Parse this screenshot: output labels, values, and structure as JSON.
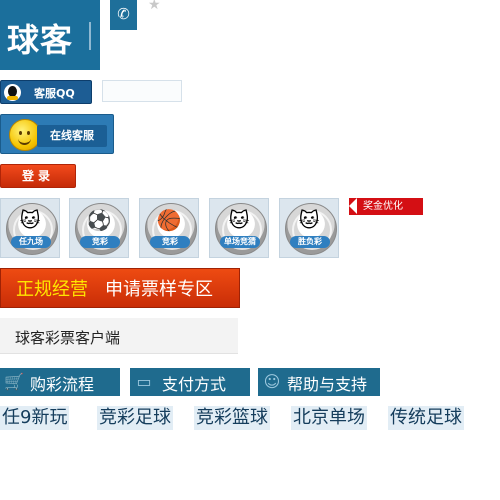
{
  "header": {
    "logo_text": "球客",
    "phone_icon": "phone-icon",
    "star_icon": "star-icon"
  },
  "service": {
    "qq_label": "客服QQ",
    "online_label": "在线客服",
    "login_label": "登录"
  },
  "games": [
    {
      "caption": "任九场",
      "icon": "cat-mascot"
    },
    {
      "caption": "竞彩",
      "icon": "soccer-ball"
    },
    {
      "caption": "竞彩",
      "icon": "basketball"
    },
    {
      "caption": "单场竞猜",
      "icon": "cat-mascot"
    },
    {
      "caption": "胜负彩",
      "icon": "cat-mascot"
    }
  ],
  "prize_tag": "奖金优化",
  "banner": {
    "part1": "正规经营",
    "part2": "申请票样专区"
  },
  "client_label": "球客彩票客户端",
  "nav": [
    {
      "label": "购彩流程",
      "icon": "cart-icon"
    },
    {
      "label": "支付方式",
      "icon": "card-icon"
    },
    {
      "label": "帮助与支持",
      "icon": "smile-icon"
    }
  ],
  "tags": [
    "任9新玩",
    "竞彩足球",
    "竞彩篮球",
    "北京单场",
    "传统足球"
  ],
  "colors": {
    "brand_blue": "#1b6f9c",
    "accent_red": "#d40f14",
    "banner_orange": "#ee4b12"
  }
}
